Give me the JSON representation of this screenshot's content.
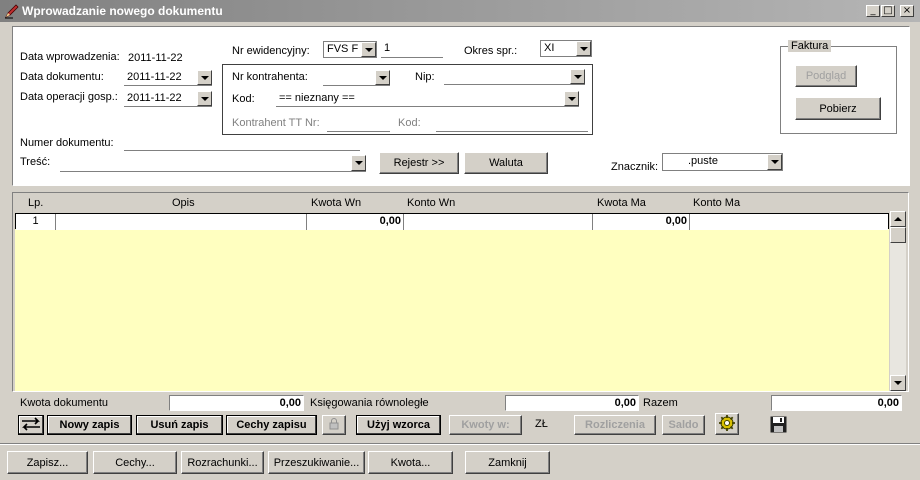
{
  "window": {
    "title": "Wprowadzanie nowego dokumentu",
    "minimize": "_",
    "maximize": "□",
    "close": "×"
  },
  "header": {
    "data_wprowadzenia_label": "Data wprowadzenia:",
    "data_wprowadzenia_value": "2011-11-22",
    "data_dokumentu_label": "Data dokumentu:",
    "data_dokumentu_value": "2011-11-22",
    "data_operacji_label": "Data operacji gosp.:",
    "data_operacji_value": "2011-11-22",
    "nr_ewid_label": "Nr ewidencyjny:",
    "nr_ewid_combo": "FVS  F",
    "nr_ewid_number": "1",
    "okres_label": "Okres spr.:",
    "okres_value": "XI",
    "nr_kontrahenta_label": "Nr kontrahenta:",
    "nr_kontrahenta_value": "",
    "nip_label": "Nip:",
    "nip_value": "",
    "kod_label": "Kod:",
    "kod_value": "== nieznany ==",
    "kontrahent_tt_label": "Kontrahent TT Nr:",
    "kod2_label": "Kod:",
    "numer_dokumentu_label": "Numer dokumentu:",
    "numer_dokumentu_value": "",
    "tresc_label": "Treść:",
    "tresc_value": "",
    "rejestr_button": "Rejestr >>",
    "waluta_button": "Waluta",
    "znacznik_label": "Znacznik:",
    "znacznik_value": ".puste"
  },
  "faktura": {
    "title": "Faktura",
    "podglad": "Podgląd",
    "pobierz": "Pobierz"
  },
  "table": {
    "columns": {
      "lp": "Lp.",
      "opis": "Opis",
      "kwota_wn": "Kwota  Wn",
      "konto_wn": "Konto  Wn",
      "kwota_ma": "Kwota Ma",
      "konto_ma": "Konto Ma"
    },
    "rows": [
      {
        "lp": "1",
        "opis": "",
        "kwota_wn": "0,00",
        "konto_wn": "",
        "kwota_ma": "0,00",
        "konto_ma": ""
      }
    ]
  },
  "summary": {
    "kwota_dokumentu_label": "Kwota dokumentu",
    "kwota_dokumentu_value": "0,00",
    "ksiegowania_label": "Księgowania równoległe",
    "ksiegowania_value": "0,00",
    "razem_label": "Razem",
    "razem_value": "0,00"
  },
  "toolbar": {
    "nowy_zapis": "Nowy zapis",
    "usun_zapis": "Usuń zapis",
    "cechy_zapisu": "Cechy zapisu",
    "uzyj_wzorca": "Użyj wzorca",
    "kwoty_wn": "Kwoty w:",
    "currency": "ZŁ",
    "rozliczenia": "Rozliczenia",
    "saldo": "Saldo"
  },
  "bottom_bar": {
    "zapisz": "Zapisz...",
    "cechy": "Cechy...",
    "rozrachunki": "Rozrachunki...",
    "przeszukiwanie": "Przeszukiwanie...",
    "kwota": "Kwota...",
    "zamknij": "Zamknij"
  },
  "colors": {
    "face": "#d4d0c8",
    "grid_bg": "#ffffc0",
    "title_grad_start": "#808080",
    "title_grad_end": "#b5b5b5"
  },
  "icons": [
    "pencil-app-icon",
    "swap-arrows-icon",
    "lock-icon",
    "gear-icon",
    "floppy-disk-icon"
  ]
}
